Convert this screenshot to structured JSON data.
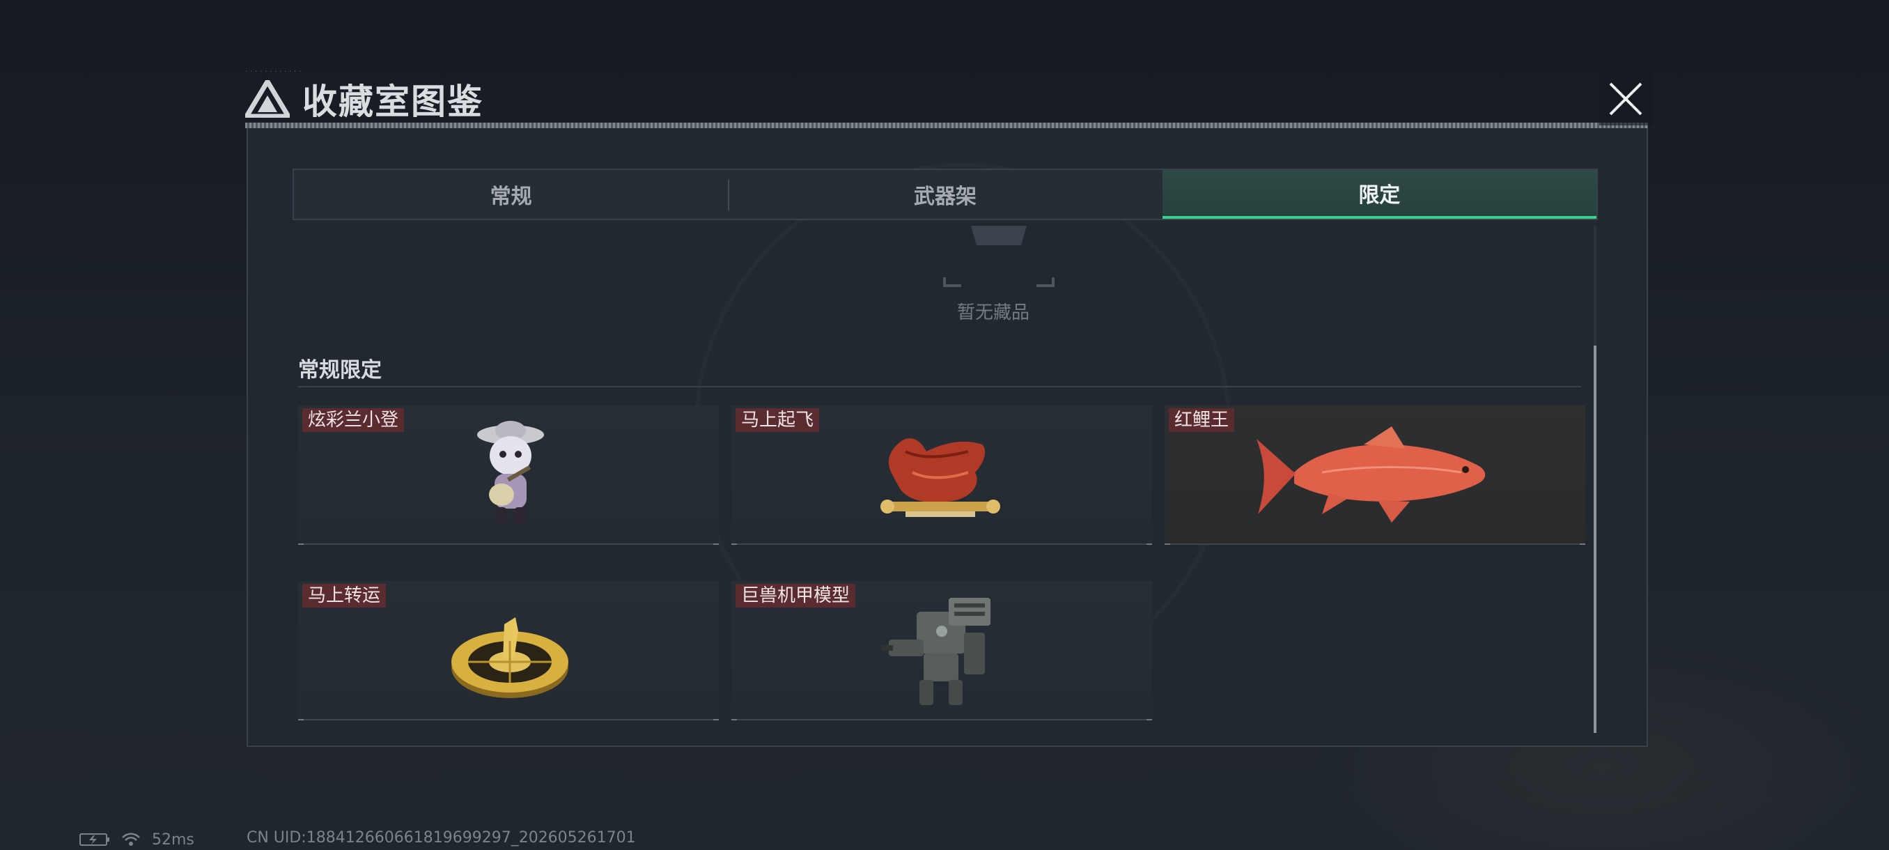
{
  "dialog": {
    "title": "收藏室图鉴"
  },
  "tabs": [
    {
      "label": "常规",
      "active": false
    },
    {
      "label": "武器架",
      "active": false
    },
    {
      "label": "限定",
      "active": true
    }
  ],
  "empty_state": {
    "text": "暂无藏品"
  },
  "section": {
    "title": "常规限定"
  },
  "items": [
    {
      "label": "炫彩兰小登",
      "icon": "figurine-with-guitar-icon"
    },
    {
      "label": "马上起飞",
      "icon": "red-horse-on-scroll-icon"
    },
    {
      "label": "红鲤王",
      "icon": "red-carp-fish-icon"
    },
    {
      "label": "马上转运",
      "icon": "golden-horse-wheel-icon"
    },
    {
      "label": "巨兽机甲模型",
      "icon": "mech-robot-model-icon"
    }
  ],
  "status": {
    "ping": "52ms",
    "uid": "CN UID:1884126606618196992​97_202605261701"
  },
  "colors": {
    "accent": "#3ccf93",
    "item_label_bg": "#5a2b2f"
  }
}
